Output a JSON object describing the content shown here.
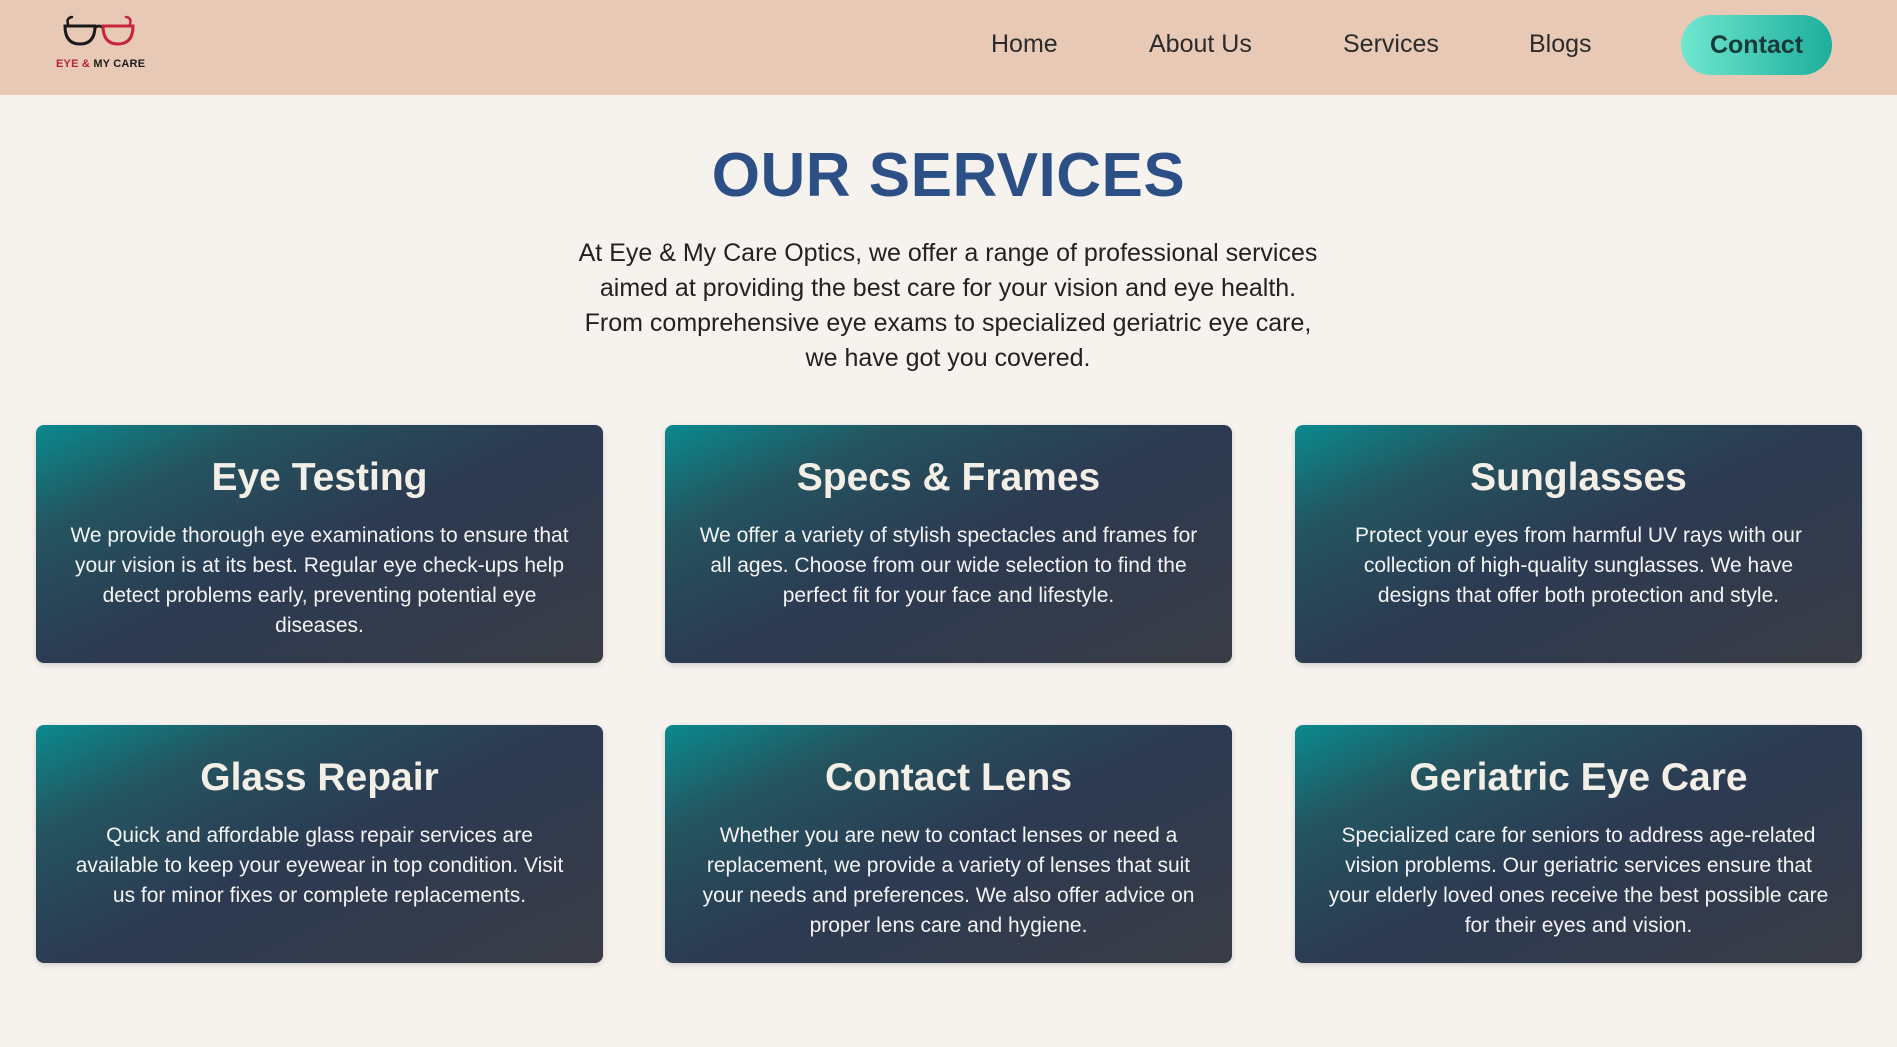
{
  "header": {
    "logo": {
      "eye_text": "EYE",
      "amp_text": "&",
      "rest_text": "MY CARE"
    },
    "nav": [
      "Home",
      "About Us",
      "Services",
      "Blogs"
    ],
    "contact_label": "Contact"
  },
  "main": {
    "title": "OUR SERVICES",
    "intro": "At Eye & My Care Optics, we offer a range of professional services aimed at providing the best care for your vision and eye health. From comprehensive eye exams to specialized geriatric eye care, we have got you covered.",
    "cards": [
      {
        "title": "Eye Testing",
        "text": "We provide thorough eye examinations to ensure that your vision is at its best. Regular eye check-ups help detect problems early, preventing potential eye diseases."
      },
      {
        "title": "Specs & Frames",
        "text": "We offer a variety of stylish spectacles and frames for all ages. Choose from our wide selection to find the perfect fit for your face and lifestyle."
      },
      {
        "title": "Sunglasses",
        "text": "Protect your eyes from harmful UV rays with our collection of high-quality sunglasses. We have designs that offer both protection and style."
      },
      {
        "title": "Glass Repair",
        "text": "Quick and affordable glass repair services are available to keep your eyewear in top condition. Visit us for minor fixes or complete replacements."
      },
      {
        "title": "Contact Lens",
        "text": "Whether you are new to contact lenses or need a replacement, we provide a variety of lenses that suit your needs and preferences. We also offer advice on proper lens care and hygiene."
      },
      {
        "title": "Geriatric Eye Care",
        "text": "Specialized care for seniors to address age-related vision problems. Our geriatric services ensure that your elderly loved ones receive the best possible care for their eyes and vision."
      }
    ]
  },
  "colors": {
    "header_bg": "#e8c9b6",
    "page_bg": "#f6f2ee",
    "title": "#2c4f86",
    "contact_button": "#3ccfb8"
  },
  "icons": {
    "logo": "glasses-icon"
  }
}
